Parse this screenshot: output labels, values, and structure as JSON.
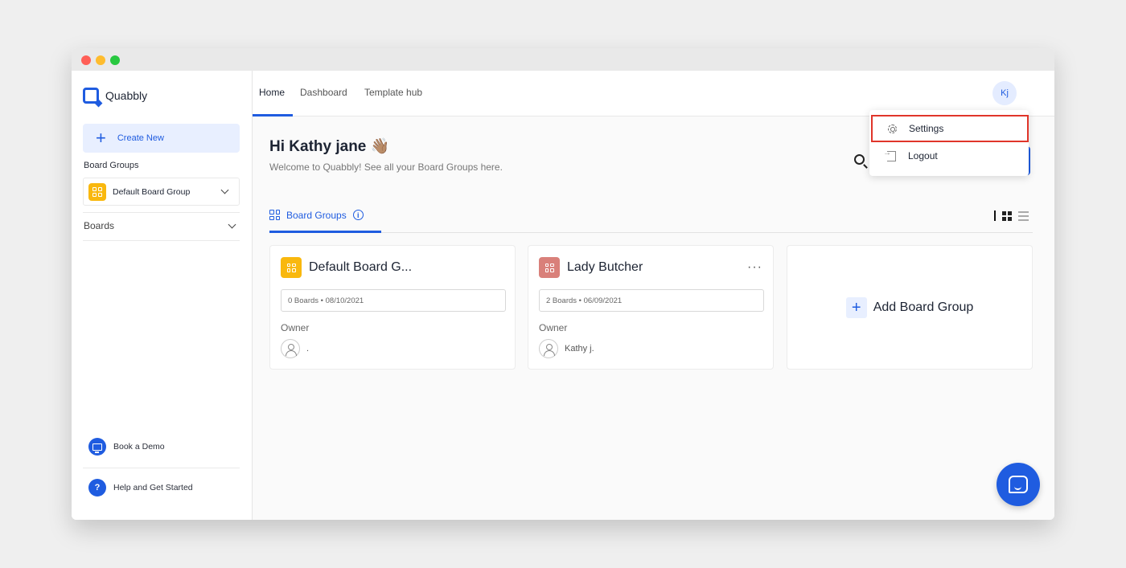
{
  "app": {
    "name": "Quabbly"
  },
  "sidebar": {
    "create_new": "Create New",
    "board_groups_title": "Board Groups",
    "group_item": "Default Board Group",
    "boards_label": "Boards",
    "book_demo": "Book a Demo",
    "help": "Help and Get Started",
    "help_icon_text": "?"
  },
  "topnav": {
    "tabs": [
      "Home",
      "Dashboard",
      "Template hub"
    ],
    "active_tab": "Home",
    "avatar_initials": "Kj"
  },
  "greeting": "Hi Kathy jane 👋🏽",
  "welcome": "Welcome to Quabbly! See all your Board Groups here.",
  "tab": {
    "label": "Board Groups",
    "info_icon_text": "i"
  },
  "cards": [
    {
      "title": "Default Board G...",
      "meta": "0 Boards • 08/10/2021",
      "owner_label": "Owner",
      "owner_name": ".",
      "icon_color": "#f9b80e"
    },
    {
      "title": "Lady Butcher",
      "meta": "2 Boards • 06/09/2021",
      "owner_label": "Owner",
      "owner_name": "Kathy j.",
      "icon_color": "#d9807a",
      "more": "···"
    }
  ],
  "add_card": {
    "label": "Add Board Group",
    "plus": "+"
  },
  "dropdown": {
    "settings": "Settings",
    "logout": "Logout"
  },
  "colors": {
    "accent": "#1f5ce0",
    "highlight": "#e0352a",
    "yellow": "#f9b80e",
    "rose": "#d9807a"
  }
}
